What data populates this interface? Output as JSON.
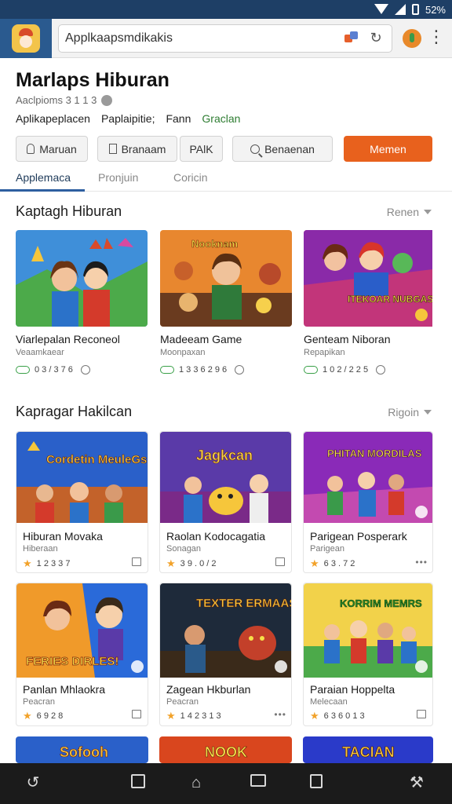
{
  "status_bar": {
    "battery": "52%"
  },
  "browser": {
    "url_text": "Applkaapsmdikakis",
    "icons": [
      "app-logo-icon",
      "puzzle-icon",
      "reload-icon",
      "profile-icon",
      "menu-icon"
    ]
  },
  "page": {
    "title": "Marlaps Hiburan",
    "meta": "Aaclpioms 3 1 1 3",
    "links": [
      "Aplikapeplacen",
      "Paplaipitie;",
      "Fann",
      "Graclan"
    ]
  },
  "actions": [
    {
      "label": "Maruan",
      "icon": "user-icon"
    },
    {
      "label": "Branaam",
      "icon": "book-icon"
    },
    {
      "label": "PAlK",
      "icon": ""
    },
    {
      "label": "Benaenan",
      "icon": "search-icon"
    },
    {
      "label": "Memen",
      "icon": ""
    }
  ],
  "tabs": [
    "Applemaca",
    "Pronjuin",
    "Coricin"
  ],
  "section1": {
    "title": "Kaptagh Hiburan",
    "more": "Renen",
    "cards": [
      {
        "title": "Viarlepalan Reconeol",
        "sub": "Veaamkaear",
        "stat": "0 3 / 3 7 6"
      },
      {
        "title": "Madeeam Game",
        "sub": "Moonpaxan",
        "stat": "1 3 3 6 2 9 6"
      },
      {
        "title": "Genteam Niboran",
        "sub": "Repapikan",
        "stat": "1 0 2 / 2 2 5"
      }
    ]
  },
  "section2": {
    "title": "Kapragar Hakilcan",
    "more": "Rigoin",
    "cards": [
      {
        "title": "Hiburan Movaka",
        "sub": "Hiberaan",
        "stat": "1 2 3 3 7"
      },
      {
        "title": "Raolan Kodocagatia",
        "sub": "Sonagan",
        "stat": "3 9 . 0 / 2"
      },
      {
        "title": "Parigean Posperark",
        "sub": "Parigean",
        "stat": "6 3 . 7 2"
      },
      {
        "title": "Panlan Mhlaokra",
        "sub": "Peacran",
        "stat": "6 9 2 8"
      },
      {
        "title": "Zagean Hkburlan",
        "sub": "Peacran",
        "stat": "1 4 2 3 1 3"
      },
      {
        "title": "Paraian Hoppelta",
        "sub": "Melecaan",
        "stat": "6 3 6 0 1 3"
      }
    ]
  },
  "banners": {
    "s1": [
      "",
      "Nooknam",
      "ITEKOAR NUBGAS"
    ],
    "s2": [
      "Cordetin MeuleGs",
      "Jagkcan",
      "PHITAN MORDILAS"
    ],
    "s3": [
      "FERIES DIRLES!",
      "TEXTER ERMAAS",
      "KORRIM MEMRS"
    ],
    "s4": [
      "Sofooh",
      "NOOK",
      "TACIAN"
    ]
  },
  "nav": [
    "back-icon",
    "square-icon",
    "home-icon",
    "screen-icon",
    "tabs-icon",
    "tools-icon"
  ]
}
